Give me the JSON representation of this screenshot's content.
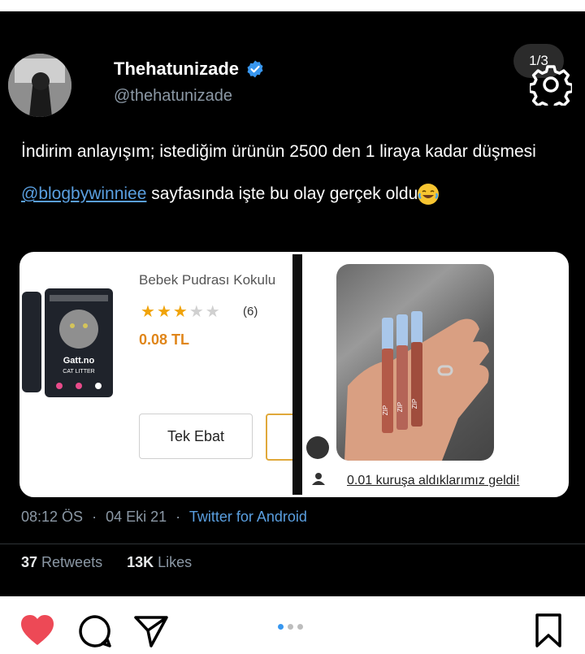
{
  "post": {
    "slide_counter": "1/3",
    "carousel": {
      "total": 3,
      "active_index": 0
    },
    "tweet": {
      "display_name": "Thehatunizade",
      "handle": "@thehatunizade",
      "verified": true,
      "text_line1": "İndirim anlayışım; istediğim ürünün 2500 den 1 liraya kadar düşmesi",
      "mention": "@blogbywinniee",
      "text_line2_rest": " sayfasında işte bu olay gerçek oldu",
      "emoji": "laughing-tears-emoji",
      "time": "08:12 ÖS",
      "date": "04 Eki 21",
      "meta_separator": "·",
      "client": "Twitter for Android",
      "retweets_count": "37",
      "retweets_label": "Retweets",
      "likes_count": "13K",
      "likes_label": "Likes"
    },
    "media": {
      "left": {
        "product_title": "Bebek Pudrası Kokulu",
        "rating": 3,
        "rating_max": 5,
        "review_count": "(6)",
        "price": "0.08 TL",
        "size_option": "Tek Ebat",
        "package_brand": "Gatt.no",
        "package_subtitle": "CAT LITTER"
      },
      "right": {
        "caption": "0.01 kuruşa aldıklarımız geldi!",
        "tube_label": "ZIP"
      }
    }
  },
  "colors": {
    "background": "#000000",
    "link": "#5a9fe0",
    "price": "#e0861a",
    "star": "#f0a30a",
    "heart": "#ed4956",
    "dot_active": "#3797f0"
  },
  "icons": [
    "gear-icon",
    "verified-badge-icon",
    "heart-icon",
    "comment-icon",
    "share-icon",
    "bookmark-icon"
  ]
}
